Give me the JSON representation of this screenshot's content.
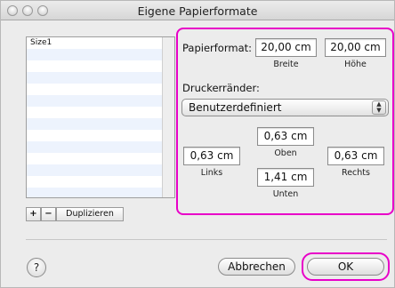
{
  "window": {
    "title": "Eigene Papierformate"
  },
  "sizes_list": {
    "items": [
      "Size1"
    ]
  },
  "list_buttons": {
    "add": "+",
    "remove": "−",
    "duplicate": "Duplizieren"
  },
  "paper_format": {
    "label": "Papierformat:",
    "width_value": "20,00 cm",
    "width_caption": "Breite",
    "height_value": "20,00 cm",
    "height_caption": "Höhe"
  },
  "margins": {
    "label": "Druckerränder:",
    "preset": "Benutzerdefiniert",
    "top_value": "0,63 cm",
    "top_caption": "Oben",
    "left_value": "0,63 cm",
    "left_caption": "Links",
    "right_value": "0,63 cm",
    "right_caption": "Rechts",
    "bottom_value": "1,41 cm",
    "bottom_caption": "Unten"
  },
  "footer": {
    "help": "?",
    "cancel": "Abbrechen",
    "ok": "OK"
  },
  "colors": {
    "highlight": "#e800c8",
    "list_alt_row": "#edf3fd"
  }
}
